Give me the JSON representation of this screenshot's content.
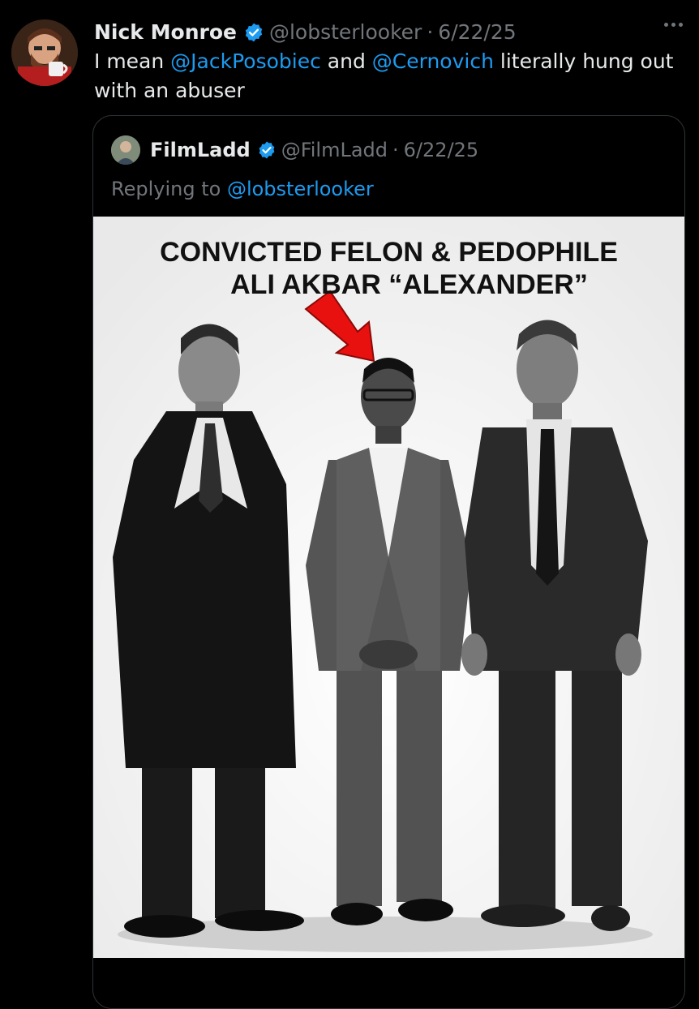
{
  "tweet": {
    "author_name": "Nick Monroe",
    "handle": "@lobsterlooker",
    "separator": "·",
    "date": "6/22/25",
    "text_parts": {
      "part1": "I mean ",
      "mention1": "@JackPosobiec",
      "part2": " and ",
      "mention2": "@Cernovich",
      "part3": " literally hung out with an abuser"
    },
    "avatar_icon": "cartoon-avatar-icon",
    "verified_color": "#1d9bf0"
  },
  "quoted_tweet": {
    "author_name": "FilmLadd",
    "handle": "@FilmLadd",
    "separator": "·",
    "date": "6/22/25",
    "replying_prefix": "Replying to ",
    "replying_to": "@lobsterlooker",
    "media": {
      "caption_line1": "CONVICTED FELON & PEDOPHILE",
      "caption_line2": "ALI AKBAR “ALEXANDER”",
      "arrow_color": "#e8110f"
    }
  },
  "colors": {
    "background": "#000000",
    "text_primary": "#e7e9ea",
    "text_secondary": "#71767b",
    "link": "#1d9bf0",
    "border": "#2f3336"
  }
}
